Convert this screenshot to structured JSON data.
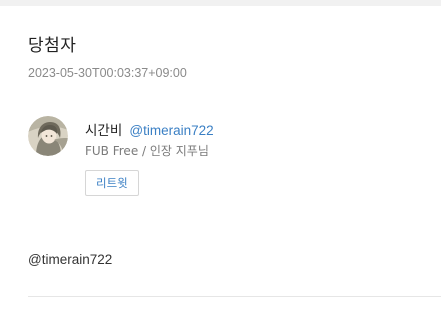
{
  "post": {
    "title": "당첨자",
    "timestamp": "2023-05-30T00:03:37+09:00"
  },
  "user": {
    "display_name": "시간비",
    "handle": "@timerain722",
    "bio": "FUB Free / 인장 지푸님",
    "avatar_icon": "user-avatar-illustration"
  },
  "actions": {
    "retweet_label": "리트윗"
  },
  "tweet": {
    "text": "@timerain722"
  },
  "colors": {
    "link": "#3a7fc4",
    "muted": "#8a8a8a",
    "text": "#333333",
    "top_strip": "#f1f1f1",
    "divider": "#e6e6e6"
  }
}
